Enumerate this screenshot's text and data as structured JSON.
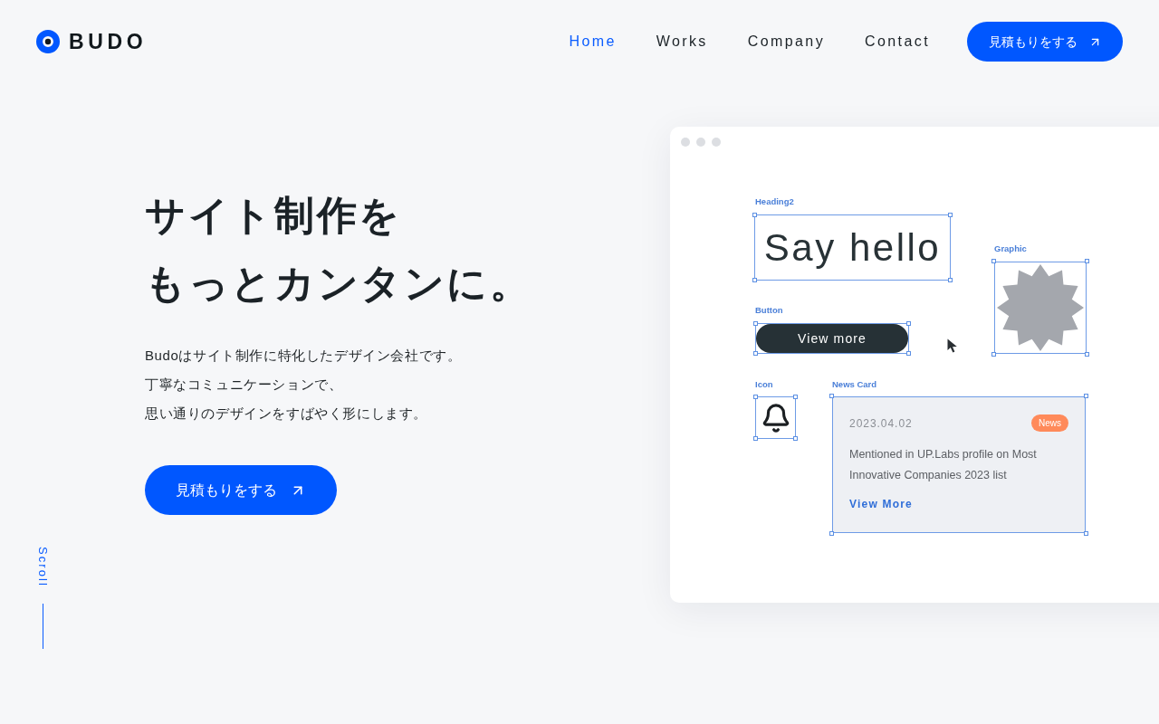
{
  "header": {
    "logo": {
      "text": "BUDO"
    },
    "nav": [
      {
        "label": "Home",
        "selected": true
      },
      {
        "label": "Works",
        "selected": false
      },
      {
        "label": "Company",
        "selected": false
      },
      {
        "label": "Contact",
        "selected": false
      }
    ],
    "cta": {
      "label": "見積もりをする"
    }
  },
  "hero": {
    "headline": [
      "サイト制作を",
      "もっとカンタンに。"
    ],
    "description": [
      "Budoはサイト制作に特化したデザイン会社です。",
      "丁寧なコミュニケーションで、",
      "思い通りのデザインをすばやく形にします。"
    ],
    "cta": {
      "label": "見積もりをする"
    }
  },
  "scroll_indicator": {
    "label": "Scroll"
  },
  "editor_preview": {
    "elements": [
      {
        "kind": "heading",
        "label": "Heading2",
        "text": "Say hello"
      },
      {
        "kind": "graphic",
        "label": "Graphic"
      },
      {
        "kind": "button",
        "label": "Button",
        "text": "View more"
      },
      {
        "kind": "icon",
        "label": "Icon"
      },
      {
        "kind": "news_card",
        "label": "News Card",
        "date": "2023.04.02",
        "tag": "News",
        "body": "Mentioned in UP.Labs profile on Most Innovative Companies 2023 list",
        "link": "View More"
      }
    ]
  }
}
